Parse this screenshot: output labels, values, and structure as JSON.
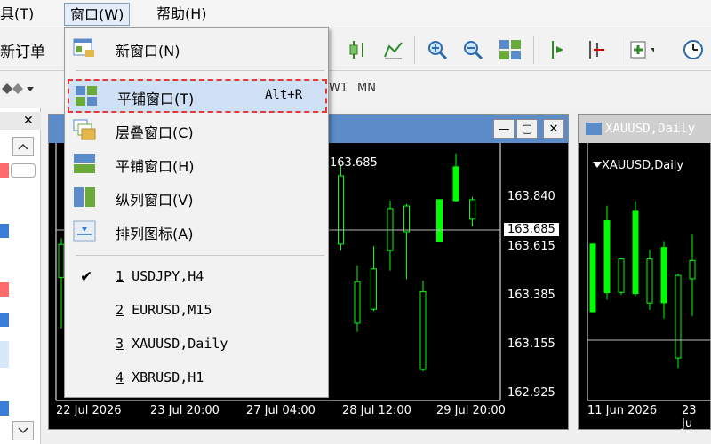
{
  "menubar": {
    "tools": "工具(T)",
    "window": "窗口(W)",
    "help": "帮助(H)"
  },
  "toolbar": {
    "new_order": "新订单",
    "timeframes": [
      "W1",
      "MN"
    ]
  },
  "menu": {
    "items": [
      {
        "label": "新窗口(N)",
        "icon": "new-window-icon"
      },
      {
        "label": "平铺窗口(T)",
        "shortcut": "Alt+R",
        "icon": "tile-windows-icon",
        "highlighted": true
      },
      {
        "label": "层叠窗口(C)",
        "icon": "cascade-windows-icon"
      },
      {
        "label": "平铺窗口(H)",
        "icon": "tile-horizontal-icon"
      },
      {
        "label": "纵列窗口(V)",
        "icon": "tile-vertical-icon"
      },
      {
        "label": "排列图标(A)",
        "icon": "arrange-icons-icon"
      }
    ],
    "windows": [
      {
        "num": "1",
        "label": "USDJPY,H4",
        "checked": true
      },
      {
        "num": "2",
        "label": "EURUSD,M15"
      },
      {
        "num": "3",
        "label": "XAUUSD,Daily"
      },
      {
        "num": "4",
        "label": "XBRUSD,H1"
      }
    ]
  },
  "chart1": {
    "current_price": "163.685",
    "price_labels": [
      "163.840",
      "163.685",
      "163.615",
      "163.385",
      "163.155",
      "162.925"
    ],
    "dates": [
      "22 Jul 2026",
      "23 Jul 20:00",
      "27 Jul 04:00",
      "28 Jul 12:00",
      "29 Jul 20:00"
    ]
  },
  "chart2": {
    "title": "XAUUSD,Daily",
    "dates": [
      "11 Jun 2026",
      "23 Ju"
    ]
  },
  "colors": {
    "accent": "#5b8bc8",
    "highlight": "#cfe0f4",
    "highlight_border": "#e53935",
    "candle": "#00ff00"
  }
}
